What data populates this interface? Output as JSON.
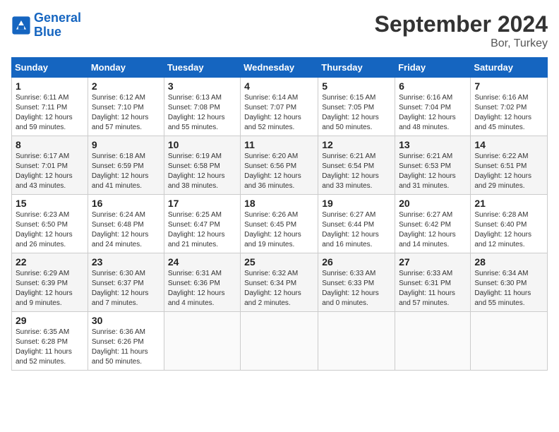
{
  "header": {
    "logo_line1": "General",
    "logo_line2": "Blue",
    "month_title": "September 2024",
    "location": "Bor, Turkey"
  },
  "days_of_week": [
    "Sunday",
    "Monday",
    "Tuesday",
    "Wednesday",
    "Thursday",
    "Friday",
    "Saturday"
  ],
  "weeks": [
    [
      {
        "day": "1",
        "sunrise": "Sunrise: 6:11 AM",
        "sunset": "Sunset: 7:11 PM",
        "daylight": "Daylight: 12 hours and 59 minutes."
      },
      {
        "day": "2",
        "sunrise": "Sunrise: 6:12 AM",
        "sunset": "Sunset: 7:10 PM",
        "daylight": "Daylight: 12 hours and 57 minutes."
      },
      {
        "day": "3",
        "sunrise": "Sunrise: 6:13 AM",
        "sunset": "Sunset: 7:08 PM",
        "daylight": "Daylight: 12 hours and 55 minutes."
      },
      {
        "day": "4",
        "sunrise": "Sunrise: 6:14 AM",
        "sunset": "Sunset: 7:07 PM",
        "daylight": "Daylight: 12 hours and 52 minutes."
      },
      {
        "day": "5",
        "sunrise": "Sunrise: 6:15 AM",
        "sunset": "Sunset: 7:05 PM",
        "daylight": "Daylight: 12 hours and 50 minutes."
      },
      {
        "day": "6",
        "sunrise": "Sunrise: 6:16 AM",
        "sunset": "Sunset: 7:04 PM",
        "daylight": "Daylight: 12 hours and 48 minutes."
      },
      {
        "day": "7",
        "sunrise": "Sunrise: 6:16 AM",
        "sunset": "Sunset: 7:02 PM",
        "daylight": "Daylight: 12 hours and 45 minutes."
      }
    ],
    [
      {
        "day": "8",
        "sunrise": "Sunrise: 6:17 AM",
        "sunset": "Sunset: 7:01 PM",
        "daylight": "Daylight: 12 hours and 43 minutes."
      },
      {
        "day": "9",
        "sunrise": "Sunrise: 6:18 AM",
        "sunset": "Sunset: 6:59 PM",
        "daylight": "Daylight: 12 hours and 41 minutes."
      },
      {
        "day": "10",
        "sunrise": "Sunrise: 6:19 AM",
        "sunset": "Sunset: 6:58 PM",
        "daylight": "Daylight: 12 hours and 38 minutes."
      },
      {
        "day": "11",
        "sunrise": "Sunrise: 6:20 AM",
        "sunset": "Sunset: 6:56 PM",
        "daylight": "Daylight: 12 hours and 36 minutes."
      },
      {
        "day": "12",
        "sunrise": "Sunrise: 6:21 AM",
        "sunset": "Sunset: 6:54 PM",
        "daylight": "Daylight: 12 hours and 33 minutes."
      },
      {
        "day": "13",
        "sunrise": "Sunrise: 6:21 AM",
        "sunset": "Sunset: 6:53 PM",
        "daylight": "Daylight: 12 hours and 31 minutes."
      },
      {
        "day": "14",
        "sunrise": "Sunrise: 6:22 AM",
        "sunset": "Sunset: 6:51 PM",
        "daylight": "Daylight: 12 hours and 29 minutes."
      }
    ],
    [
      {
        "day": "15",
        "sunrise": "Sunrise: 6:23 AM",
        "sunset": "Sunset: 6:50 PM",
        "daylight": "Daylight: 12 hours and 26 minutes."
      },
      {
        "day": "16",
        "sunrise": "Sunrise: 6:24 AM",
        "sunset": "Sunset: 6:48 PM",
        "daylight": "Daylight: 12 hours and 24 minutes."
      },
      {
        "day": "17",
        "sunrise": "Sunrise: 6:25 AM",
        "sunset": "Sunset: 6:47 PM",
        "daylight": "Daylight: 12 hours and 21 minutes."
      },
      {
        "day": "18",
        "sunrise": "Sunrise: 6:26 AM",
        "sunset": "Sunset: 6:45 PM",
        "daylight": "Daylight: 12 hours and 19 minutes."
      },
      {
        "day": "19",
        "sunrise": "Sunrise: 6:27 AM",
        "sunset": "Sunset: 6:44 PM",
        "daylight": "Daylight: 12 hours and 16 minutes."
      },
      {
        "day": "20",
        "sunrise": "Sunrise: 6:27 AM",
        "sunset": "Sunset: 6:42 PM",
        "daylight": "Daylight: 12 hours and 14 minutes."
      },
      {
        "day": "21",
        "sunrise": "Sunrise: 6:28 AM",
        "sunset": "Sunset: 6:40 PM",
        "daylight": "Daylight: 12 hours and 12 minutes."
      }
    ],
    [
      {
        "day": "22",
        "sunrise": "Sunrise: 6:29 AM",
        "sunset": "Sunset: 6:39 PM",
        "daylight": "Daylight: 12 hours and 9 minutes."
      },
      {
        "day": "23",
        "sunrise": "Sunrise: 6:30 AM",
        "sunset": "Sunset: 6:37 PM",
        "daylight": "Daylight: 12 hours and 7 minutes."
      },
      {
        "day": "24",
        "sunrise": "Sunrise: 6:31 AM",
        "sunset": "Sunset: 6:36 PM",
        "daylight": "Daylight: 12 hours and 4 minutes."
      },
      {
        "day": "25",
        "sunrise": "Sunrise: 6:32 AM",
        "sunset": "Sunset: 6:34 PM",
        "daylight": "Daylight: 12 hours and 2 minutes."
      },
      {
        "day": "26",
        "sunrise": "Sunrise: 6:33 AM",
        "sunset": "Sunset: 6:33 PM",
        "daylight": "Daylight: 12 hours and 0 minutes."
      },
      {
        "day": "27",
        "sunrise": "Sunrise: 6:33 AM",
        "sunset": "Sunset: 6:31 PM",
        "daylight": "Daylight: 11 hours and 57 minutes."
      },
      {
        "day": "28",
        "sunrise": "Sunrise: 6:34 AM",
        "sunset": "Sunset: 6:30 PM",
        "daylight": "Daylight: 11 hours and 55 minutes."
      }
    ],
    [
      {
        "day": "29",
        "sunrise": "Sunrise: 6:35 AM",
        "sunset": "Sunset: 6:28 PM",
        "daylight": "Daylight: 11 hours and 52 minutes."
      },
      {
        "day": "30",
        "sunrise": "Sunrise: 6:36 AM",
        "sunset": "Sunset: 6:26 PM",
        "daylight": "Daylight: 11 hours and 50 minutes."
      },
      null,
      null,
      null,
      null,
      null
    ]
  ]
}
